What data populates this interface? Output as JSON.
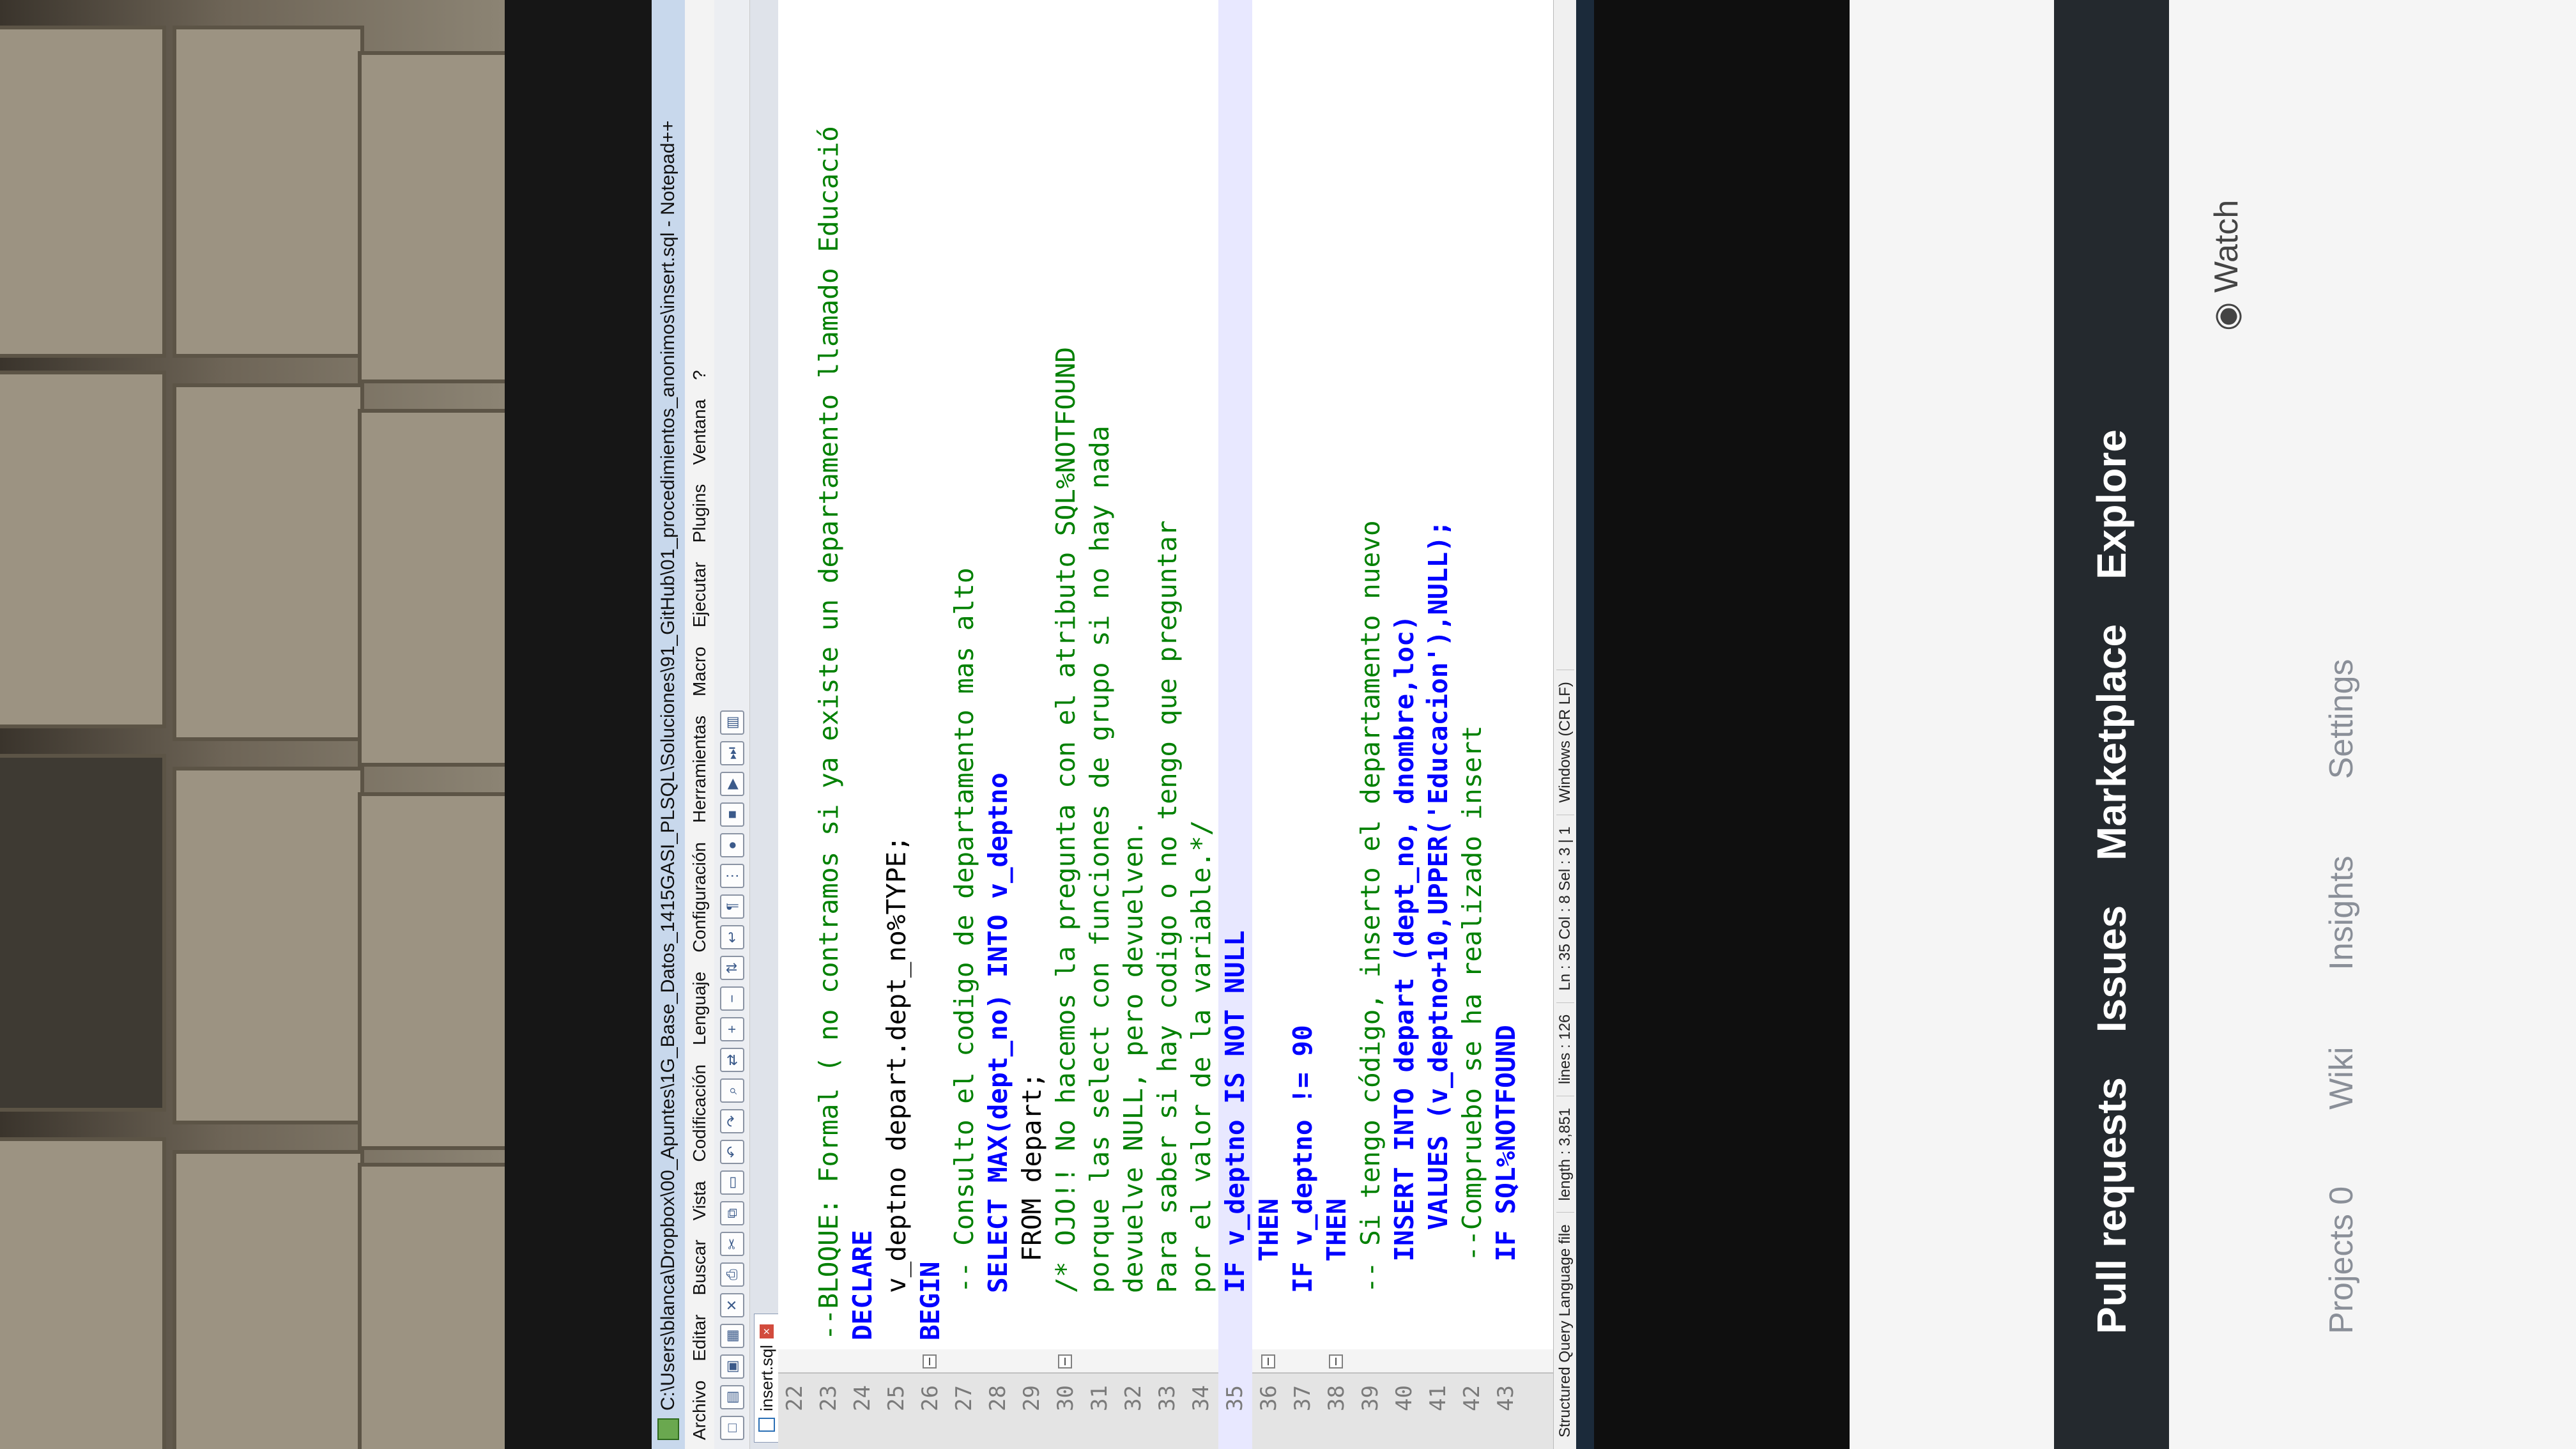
{
  "window": {
    "title": "C:\\Users\\blanca\\Dropbox\\00_Apuntes\\1G_Base_Datos_1415GASI_PLSQL\\Soluciones\\91_GitHub\\01_procedimientos_anonimos\\insert.sql - Notepad++"
  },
  "menu": [
    "Archivo",
    "Editar",
    "Buscar",
    "Vista",
    "Codificación",
    "Lenguaje",
    "Configuración",
    "Herramientas",
    "Macro",
    "Ejecutar",
    "Plugins",
    "Ventana",
    "?"
  ],
  "tab": {
    "label": "insert.sql"
  },
  "editor": {
    "lines": [
      {
        "num": "22",
        "text": ""
      },
      {
        "num": "23",
        "text": "--BLOQUE: Formal ( no contramos si ya existe un departamento llamado Educació"
      },
      {
        "num": "24",
        "text": "DECLARE"
      },
      {
        "num": "25",
        "text": "   v_deptno depart.dept_no%TYPE;"
      },
      {
        "num": "26",
        "text": "BEGIN"
      },
      {
        "num": "27",
        "text": "   -- Consulto el codigo de departamento mas alto"
      },
      {
        "num": "28",
        "text": "   SELECT MAX(dept_no) INTO v_deptno"
      },
      {
        "num": "29",
        "text": "     FROM depart;"
      },
      {
        "num": "30",
        "text": "   /* OJO!! No hacemos la pregunta con el atributo SQL%NOTFOUND"
      },
      {
        "num": "31",
        "text": "   porque las select con funciones de grupo si no hay nada"
      },
      {
        "num": "32",
        "text": "   devuelve NULL, pero devuelven."
      },
      {
        "num": "33",
        "text": "   Para saber si hay codigo o no tengo que preguntar"
      },
      {
        "num": "34",
        "text": "   por el valor de la variable.*/"
      },
      {
        "num": "35",
        "text": "   IF v_deptno IS NOT NULL"
      },
      {
        "num": "36",
        "text": "     THEN"
      },
      {
        "num": "37",
        "text": "   IF v_deptno != 90"
      },
      {
        "num": "38",
        "text": "     THEN"
      },
      {
        "num": "39",
        "text": "   -- Si tengo código, inserto el departamento nuevo"
      },
      {
        "num": "40",
        "text": "     INSERT INTO depart (dept_no, dnombre,loc)"
      },
      {
        "num": "41",
        "text": "       VALUES (v_deptno+10,UPPER('Educacion'),NULL);"
      },
      {
        "num": "42",
        "text": "     --Compruebo se ha realizado insert"
      },
      {
        "num": "43",
        "text": "     IF SQL%NOTFOUND"
      }
    ]
  },
  "status": {
    "language": "Structured Query Language file",
    "length": "length : 3,851",
    "lines": "lines : 126",
    "position": "Ln : 35   Col : 8   Sel : 3 | 1",
    "eol": "Windows (CR LF)"
  },
  "github": {
    "nav": [
      "Pull requests",
      "Issues",
      "Marketplace",
      "Explore"
    ],
    "repo_tabs": [
      "Projects 0",
      "Wiki",
      "Insights",
      "Settings"
    ],
    "watch": "Watch"
  }
}
